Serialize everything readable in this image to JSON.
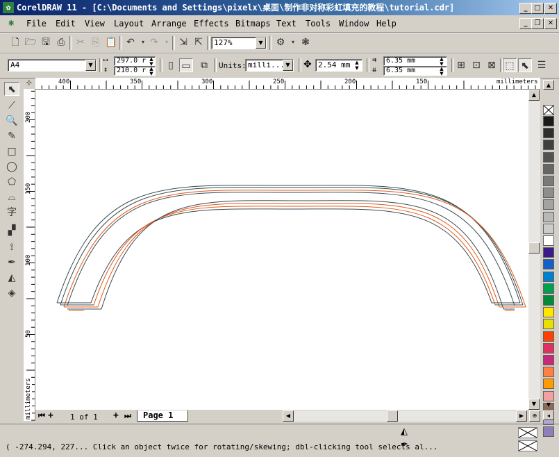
{
  "window": {
    "title": "CorelDRAW 11 - [C:\\Documents and Settings\\pixelx\\桌面\\制作非对称彩虹填充的教程\\tutorial.cdr]",
    "buttons": [
      "minimize",
      "maximize",
      "close"
    ]
  },
  "menu": {
    "items": [
      "File",
      "Edit",
      "View",
      "Layout",
      "Arrange",
      "Effects",
      "Bitmaps",
      "Text",
      "Tools",
      "Window",
      "Help"
    ]
  },
  "standard_toolbar": {
    "zoom": "127%",
    "icons": [
      "new-icon",
      "open-icon",
      "save-icon",
      "print-icon",
      "cut-icon",
      "copy-icon",
      "paste-icon",
      "undo-icon",
      "redo-icon",
      "import-icon",
      "export-icon",
      "application-launcher-icon",
      "corel-online-icon"
    ]
  },
  "property_bar": {
    "paper_size": "A4",
    "width": "297.0 r",
    "height": "210.0 r",
    "units_label": "Units:",
    "units_value": "milli...",
    "nudge": "2.54 mm",
    "dup_x": "6.35 mm",
    "dup_y": "6.35 mm"
  },
  "rulers": {
    "unit": "millimeters",
    "h_labels": [
      "400",
      "350",
      "300",
      "250",
      "200",
      "150"
    ],
    "v_labels": [
      "200",
      "150",
      "100",
      "50"
    ]
  },
  "page_nav": {
    "page_count": "1 of 1",
    "tab": "Page 1"
  },
  "status": {
    "text": "( -274.294, 227... Click an object twice for rotating/skewing; dbl-clicking tool selects al..."
  },
  "palette": {
    "colors": [
      "#ffffff",
      "#1a1a1a",
      "#2e2e2e",
      "#3f3f3f",
      "#535353",
      "#666666",
      "#7a7a7a",
      "#8e8e8e",
      "#a3a3a3",
      "#b8b8b8",
      "#cccccc",
      "#ffffff",
      "#3b1a8a",
      "#1560c8",
      "#007fcc",
      "#00a050",
      "#008a3a",
      "#ffe600",
      "#e8e000",
      "#ff4000",
      "#e03060",
      "#c8287a",
      "#ff8040",
      "#ff9a00",
      "#f2a0a0",
      "#8a6a58",
      "#b0a8d0",
      "#8e7ebc"
    ]
  },
  "arcs": {
    "outline_color": "#3a4a50",
    "inner_color": "#e05818"
  }
}
